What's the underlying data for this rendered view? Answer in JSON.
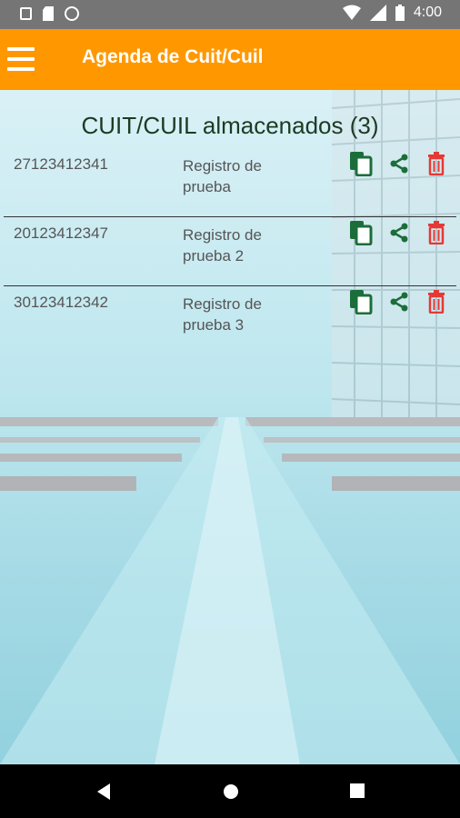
{
  "status_bar": {
    "time": "4:00",
    "left_icons": [
      "a-icon",
      "sd-card-icon",
      "circle-icon"
    ],
    "right_icons": [
      "wifi-icon",
      "signal-icon",
      "battery-icon"
    ]
  },
  "app_bar": {
    "title": "Agenda de Cuit/Cuil",
    "color": "#ff9800"
  },
  "heading": "CUIT/CUIL almacenados (3)",
  "records": [
    {
      "cuit": "27123412341",
      "description": "Registro de prueba"
    },
    {
      "cuit": "20123412347",
      "description": "Registro de prueba 2"
    },
    {
      "cuit": "30123412342",
      "description": "Registro de prueba 3"
    }
  ],
  "colors": {
    "copy_icon": "#1b6e3a",
    "share_icon": "#1b6e3a",
    "delete_icon": "#e53935"
  },
  "nav_bar": {
    "buttons": [
      "back-icon",
      "home-icon",
      "recents-icon"
    ]
  }
}
